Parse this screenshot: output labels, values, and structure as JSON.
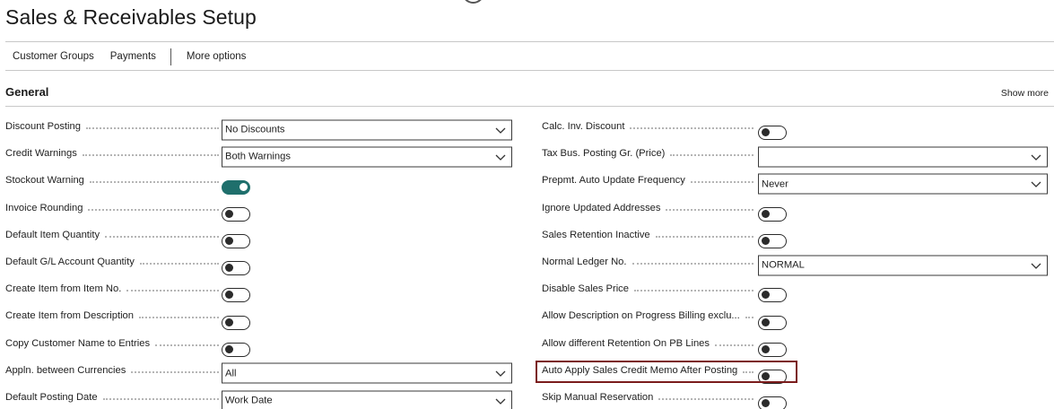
{
  "page": {
    "title": "Sales & Receivables Setup"
  },
  "actions": {
    "customer_groups": "Customer Groups",
    "payments": "Payments",
    "more_options": "More options"
  },
  "section": {
    "title": "General",
    "show_more": "Show more"
  },
  "left_fields": [
    {
      "label": "Discount Posting",
      "type": "select",
      "value": "No Discounts"
    },
    {
      "label": "Credit Warnings",
      "type": "select",
      "value": "Both Warnings"
    },
    {
      "label": "Stockout Warning",
      "type": "toggle",
      "on": true
    },
    {
      "label": "Invoice Rounding",
      "type": "toggle",
      "on": false
    },
    {
      "label": "Default Item Quantity",
      "type": "toggle",
      "on": false
    },
    {
      "label": "Default G/L Account Quantity",
      "type": "toggle",
      "on": false
    },
    {
      "label": "Create Item from Item No.",
      "type": "toggle",
      "on": false
    },
    {
      "label": "Create Item from Description",
      "type": "toggle",
      "on": false
    },
    {
      "label": "Copy Customer Name to Entries",
      "type": "toggle",
      "on": false
    },
    {
      "label": "Appln. between Currencies",
      "type": "select",
      "value": "All"
    },
    {
      "label": "Default Posting Date",
      "type": "select",
      "value": "Work Date"
    }
  ],
  "right_fields": [
    {
      "label": "Calc. Inv. Discount",
      "type": "toggle",
      "on": false
    },
    {
      "label": "Tax Bus. Posting Gr. (Price)",
      "type": "select",
      "value": ""
    },
    {
      "label": "Prepmt. Auto Update Frequency",
      "type": "select",
      "value": "Never"
    },
    {
      "label": "Ignore Updated Addresses",
      "type": "toggle",
      "on": false
    },
    {
      "label": "Sales Retention Inactive",
      "type": "toggle",
      "on": false
    },
    {
      "label": "Normal Ledger No.",
      "type": "select",
      "value": "NORMAL"
    },
    {
      "label": "Disable Sales Price",
      "type": "toggle",
      "on": false
    },
    {
      "label": "Allow Description on Progress Billing exclu...",
      "type": "toggle",
      "on": false
    },
    {
      "label": "Allow different Retention On PB Lines",
      "type": "toggle",
      "on": false
    },
    {
      "label": "Auto Apply Sales Credit Memo After Posting",
      "type": "toggle",
      "on": false
    },
    {
      "label": "Skip Manual Reservation",
      "type": "toggle",
      "on": false
    }
  ],
  "colors": {
    "toggle_on": "#1f6f6c",
    "highlight": "#7b1c1c"
  }
}
